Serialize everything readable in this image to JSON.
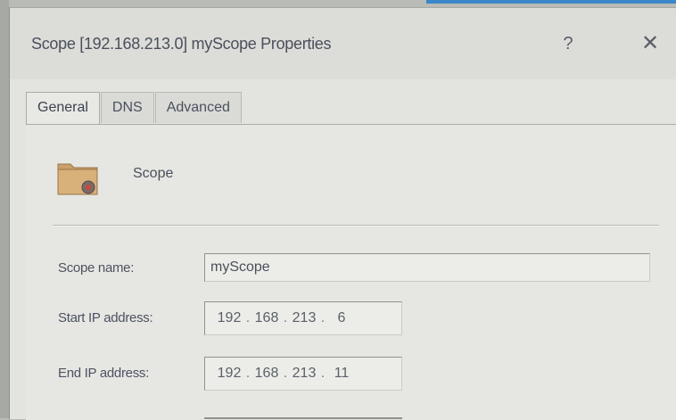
{
  "window": {
    "title": "Scope [192.168.213.0] myScope Properties",
    "help_label": "?",
    "close_label": "✕"
  },
  "tabs": [
    {
      "label": "General",
      "active": true
    },
    {
      "label": "DNS",
      "active": false
    },
    {
      "label": "Advanced",
      "active": false
    }
  ],
  "general": {
    "header_label": "Scope",
    "header_icon": "folder-icon",
    "scope_name_label": "Scope name:",
    "scope_name_value": "myScope",
    "start_ip_label": "Start IP address:",
    "start_ip": [
      "192",
      "168",
      "213",
      "6"
    ],
    "end_ip_label": "End IP address:",
    "end_ip": [
      "192",
      "168",
      "213",
      "11"
    ]
  },
  "colors": {
    "accent": "#3b86c8",
    "folder": "#c9a06a"
  }
}
